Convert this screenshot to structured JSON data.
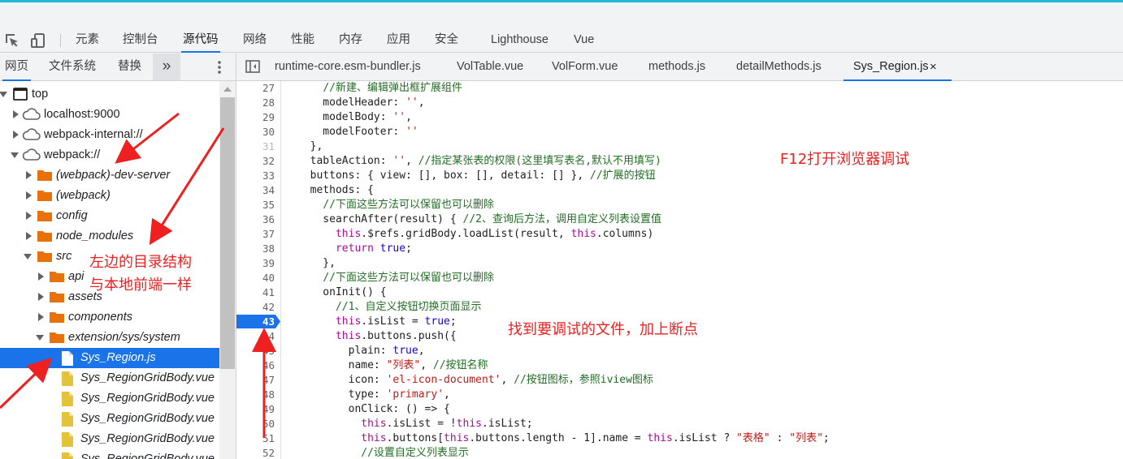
{
  "toolbar": {
    "tabs": [
      "元素",
      "控制台",
      "源代码",
      "网络",
      "性能",
      "内存",
      "应用",
      "安全",
      "Lighthouse",
      "Vue"
    ],
    "active_tab": "源代码",
    "icons": [
      "inspect-element-icon",
      "device-toolbar-icon"
    ]
  },
  "navigator": {
    "tabs": [
      "网页",
      "文件系统",
      "替换"
    ],
    "active_tab": "网页",
    "more_label": "»",
    "tree": [
      {
        "label": "top",
        "icon": "frame-icon",
        "expanded": true
      },
      {
        "label": "localhost:9000",
        "icon": "cloud-icon",
        "expanded": false
      },
      {
        "label": "webpack-internal://",
        "icon": "cloud-icon",
        "expanded": false
      },
      {
        "label": "webpack://",
        "icon": "cloud-icon",
        "expanded": true
      },
      {
        "label": "(webpack)-dev-server",
        "icon": "folder-icon",
        "expanded": false
      },
      {
        "label": "(webpack)",
        "icon": "folder-icon",
        "expanded": false
      },
      {
        "label": "config",
        "icon": "folder-icon",
        "expanded": false
      },
      {
        "label": "node_modules",
        "icon": "folder-icon",
        "expanded": false
      },
      {
        "label": "src",
        "icon": "folder-icon",
        "expanded": true
      },
      {
        "label": "api",
        "icon": "folder-icon",
        "expanded": false
      },
      {
        "label": "assets",
        "icon": "folder-icon",
        "expanded": false
      },
      {
        "label": "components",
        "icon": "folder-icon",
        "expanded": false
      },
      {
        "label": "extension/sys/system",
        "icon": "folder-icon",
        "expanded": true
      },
      {
        "label": "Sys_Region.js",
        "icon": "file-icon",
        "selected": true
      },
      {
        "label": "Sys_RegionGridBody.vue",
        "icon": "file-icon"
      },
      {
        "label": "Sys_RegionGridBody.vue",
        "icon": "file-icon"
      },
      {
        "label": "Sys_RegionGridBody.vue",
        "icon": "file-icon"
      },
      {
        "label": "Sys_RegionGridBody.vue",
        "icon": "file-icon"
      },
      {
        "label": "Sys_RegionGridBody.vue",
        "icon": "file-icon"
      }
    ]
  },
  "editor": {
    "tabs": [
      "runtime-core.esm-bundler.js",
      "VolTable.vue",
      "VolForm.vue",
      "methods.js",
      "detailMethods.js",
      "Sys_Region.js"
    ],
    "active_tab": "Sys_Region.js",
    "close_label": "×",
    "breakpoint_line": 43,
    "lines": [
      {
        "n": "27",
        "code": "    //新建、编辑弹出框扩展组件"
      },
      {
        "n": "28",
        "code": "    modelHeader: '',"
      },
      {
        "n": "29",
        "code": "    modelBody: '',"
      },
      {
        "n": "30",
        "code": "    modelFooter: ''"
      },
      {
        "n": "31",
        "code": "  },"
      },
      {
        "n": "32",
        "code": "  tableAction: '', //指定某张表的权限(这里填写表名,默认不用填写)"
      },
      {
        "n": "33",
        "code": "  buttons: { view: [], box: [], detail: [] }, //扩展的按钮"
      },
      {
        "n": "34",
        "code": "  methods: {"
      },
      {
        "n": "35",
        "code": "    //下面这些方法可以保留也可以删除"
      },
      {
        "n": "36",
        "code": "    searchAfter(result) { //2、查询后方法，调用自定义列表设置值"
      },
      {
        "n": "37",
        "code": "      this.$refs.gridBody.loadList(result, this.columns)"
      },
      {
        "n": "38",
        "code": "      return true;"
      },
      {
        "n": "39",
        "code": "    },"
      },
      {
        "n": "40",
        "code": "    //下面这些方法可以保留也可以删除"
      },
      {
        "n": "41",
        "code": "    onInit() {"
      },
      {
        "n": "42",
        "code": "      //1、自定义按钮切换页面显示"
      },
      {
        "n": "43",
        "code": "      this.isList = true;"
      },
      {
        "n": "44",
        "code": "      this.buttons.push({"
      },
      {
        "n": "45",
        "code": "        plain: true,"
      },
      {
        "n": "46",
        "code": "        name: \"列表\", //按钮名称"
      },
      {
        "n": "47",
        "code": "        icon: 'el-icon-document', //按钮图标，参照iview图标"
      },
      {
        "n": "48",
        "code": "        type: 'primary',"
      },
      {
        "n": "49",
        "code": "        onClick: () => {"
      },
      {
        "n": "50",
        "code": "          this.isList = !this.isList;"
      },
      {
        "n": "51",
        "code": "          this.buttons[this.buttons.length - 1].name = this.isList ? \"表格\" : \"列表\";"
      },
      {
        "n": "52",
        "code": "          //设置自定义列表显示"
      }
    ]
  },
  "annotations": {
    "devtools_hint": "F12打开浏览器调试",
    "tree_hint_line1": "左边的目录结构",
    "tree_hint_line2": "与本地前端一样",
    "breakpoint_hint": "找到要调试的文件，加上断点"
  },
  "colors": {
    "accent": "#1a73e8",
    "annotation": "#ee2020",
    "folder": "#e8710a",
    "file_vue": "#e3c33b",
    "comment": "#236e25",
    "keyword": "#aa0d91",
    "string": "#c41a16"
  }
}
